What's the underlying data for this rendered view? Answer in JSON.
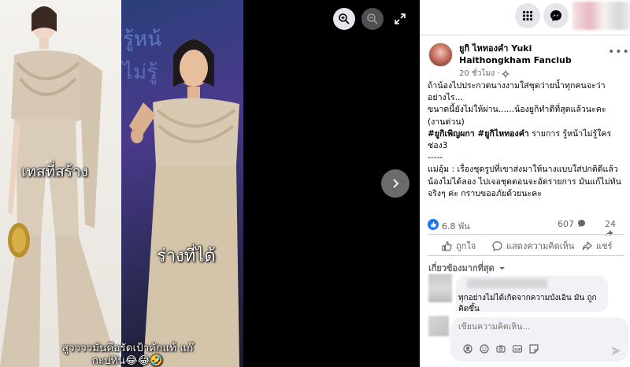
{
  "viewer": {
    "caption_left": "เทสที่สร้าง",
    "caption_right": "ร่างที่ได้",
    "caption_bottom": "สูววววมันคือรัดเป้าคักแท้ แก๊กะบ่ทัน😂😂🤣"
  },
  "post": {
    "page_name": "ยูกิ ไหทองคำ Yuki Haithongkham Fanclub",
    "time": "20 ชั่วโมง",
    "body_lines": [
      "ถ้าน้องไปประกวดนางงามใส่ชุดว่ายน้ำทุกคนจะว่าอย่างไร...",
      "ขนาดนี้ยังไม่ให้ผ่าน......น้องยูกิทำดีที่สุดแล้วนะคะ (งานด่วน)"
    ],
    "hashtags": "#ยูกิเพิญผกา #ยูกิไหทองคำ",
    "program_line": " รายการ รู้หน้าไม่รู้ใคร ช่อง3",
    "separator": "-----",
    "note": "แม่อุ้ม : เรื่องชุดรูปที่เขาส่งมาให้นางแบบใส่ปกติดีแล้วน้องไม่ได้ลอง ไปเจอชุดตอนจะอัดรายการ มันแก้ไม่ทันจริงๆ ค่ะ กราบขออภัยด้วยนะคะ"
  },
  "stats": {
    "reactions": "6.8 พัน",
    "comments": "607",
    "shares": "24"
  },
  "actions": {
    "like": "ถูกใจ",
    "comment": "แสดงความคิดเห็น",
    "share": "แชร์"
  },
  "comments_filter": "เกี่ยวข้องมากที่สุด",
  "comment": {
    "text": "ทุกอย่างไม่ได้เกิดจากความบังเอิน มัน ถูกคิดขึ้น"
  },
  "composer": {
    "placeholder": "เขียนความคิดเห็น..."
  },
  "colors": {
    "accent": "#1877f2",
    "secondary_text": "#65676b",
    "bubble": "#f0f2f5"
  }
}
